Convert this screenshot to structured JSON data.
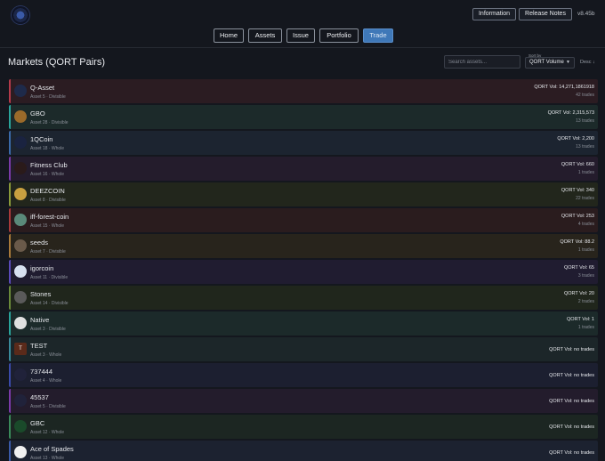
{
  "header": {
    "logo_icon": "qortal-logo-icon",
    "information_label": "Information",
    "release_notes_label": "Release Notes",
    "version": "v8.45b"
  },
  "nav": {
    "tabs": [
      {
        "label": "Home"
      },
      {
        "label": "Assets"
      },
      {
        "label": "Issue"
      },
      {
        "label": "Portfolio"
      },
      {
        "label": "Trade",
        "active": true
      }
    ]
  },
  "main": {
    "title": "Markets (QORT Pairs)",
    "search_placeholder": "Search assets...",
    "sort_label": "Sort by",
    "sort_value": "QORT Volume",
    "sort_direction": "Desc ↓"
  },
  "colors": {
    "accent_active_tab": "#3f78b8",
    "page_background": "#14171e"
  },
  "markets": [
    {
      "name": "Q-Asset",
      "sub": "Asset 5 · Divisible",
      "vol": "QORT Vol: 14,271,1861918",
      "trades": "42 trades",
      "accent": "#b33a4a",
      "bg": "#2b1c22",
      "thumb_bg": "#1e2a4a",
      "icon": "q-asset-icon"
    },
    {
      "name": "GBO",
      "sub": "Asset 28 · Divisible",
      "vol": "QORT Vol: 2,315,573",
      "trades": "13 trades",
      "accent": "#2aa39a",
      "bg": "#1c2a2a",
      "thumb_bg": "#9a6a2a",
      "icon": "gold-bar-icon"
    },
    {
      "name": "1QCoin",
      "sub": "Asset 18 · Whole",
      "vol": "QORT Vol: 2,200",
      "trades": "13 trades",
      "accent": "#3a6aa8",
      "bg": "#1c2430",
      "thumb_bg": "#1a2340",
      "icon": "q-coin-icon"
    },
    {
      "name": "Fitness Club",
      "sub": "Asset 16 · Whole",
      "vol": "QORT Vol: 660",
      "trades": "1 trades",
      "accent": "#7a3aa8",
      "bg": "#241c2c",
      "thumb_bg": "#2a1a1a",
      "icon": "fitness-club-icon"
    },
    {
      "name": "DEEZCOIN",
      "sub": "Asset 8 · Divisible",
      "vol": "QORT Vol: 340",
      "trades": "22 trades",
      "accent": "#8a9a3a",
      "bg": "#22261c",
      "thumb_bg": "#c8a040",
      "icon": "deezcoin-icon"
    },
    {
      "name": "iff-forest-coin",
      "sub": "Asset 15 · Whole",
      "vol": "QORT Vol: 253",
      "trades": "4 trades",
      "accent": "#a83a3a",
      "bg": "#2a1c1e",
      "thumb_bg": "#5a8a7a",
      "icon": "forest-coin-icon"
    },
    {
      "name": "seeds",
      "sub": "Asset 7 · Divisible",
      "vol": "QORT Vol: 88.2",
      "trades": "1 trades",
      "accent": "#a87a3a",
      "bg": "#28241c",
      "thumb_bg": "#6a5a4a",
      "icon": "seeds-icon"
    },
    {
      "name": "igorcoin",
      "sub": "Asset 11 · Divisible",
      "vol": "QORT Vol: 65",
      "trades": "3 trades",
      "accent": "#5a4ab8",
      "bg": "#201c30",
      "thumb_bg": "#d8e0f0",
      "icon": "igorcoin-icon"
    },
    {
      "name": "Stones",
      "sub": "Asset 14 · Divisible",
      "vol": "QORT Vol: 20",
      "trades": "2 trades",
      "accent": "#6a8a3a",
      "bg": "#20261c",
      "thumb_bg": "#5a5a5a",
      "icon": "stones-icon"
    },
    {
      "name": "Native",
      "sub": "Asset 3 · Divisible",
      "vol": "QORT Vol: 1",
      "trades": "1 trades",
      "accent": "#2aa39a",
      "bg": "#1c2a2a",
      "thumb_bg": "#e0e0e0",
      "icon": "native-icon"
    },
    {
      "name": "TEST",
      "sub": "Asset 3 · Whole",
      "vol": "QORT Vol: no trades",
      "trades": "",
      "accent": "#3a8a9a",
      "bg": "#1c2629",
      "thumb_bg": "#5a2a1a",
      "icon": "test-icon",
      "thumb_text": "T"
    },
    {
      "name": "737444",
      "sub": "Asset 4 · Whole",
      "vol": "QORT Vol: no trades",
      "trades": "",
      "accent": "#3a4aa8",
      "bg": "#1c1f30",
      "thumb_bg": "#20223a",
      "icon": "hosting-house-icon"
    },
    {
      "name": "45537",
      "sub": "Asset 5 · Divisible",
      "vol": "QORT Vol: no trades",
      "trades": "",
      "accent": "#7a3aa8",
      "bg": "#231c2c",
      "thumb_bg": "#20223a",
      "icon": "hosting-house-icon"
    },
    {
      "name": "GBC",
      "sub": "Asset 12 · Whole",
      "vol": "QORT Vol: no trades",
      "trades": "",
      "accent": "#3a8a5a",
      "bg": "#1c2622",
      "thumb_bg": "#1a4a2a",
      "icon": "gbc-icon"
    },
    {
      "name": "Ace of Spades",
      "sub": "Asset 13 · Whole",
      "vol": "QORT Vol: no trades",
      "trades": "",
      "accent": "#3a5aa8",
      "bg": "#1c2230",
      "thumb_bg": "#f0f0f0",
      "icon": "spade-icon"
    }
  ]
}
